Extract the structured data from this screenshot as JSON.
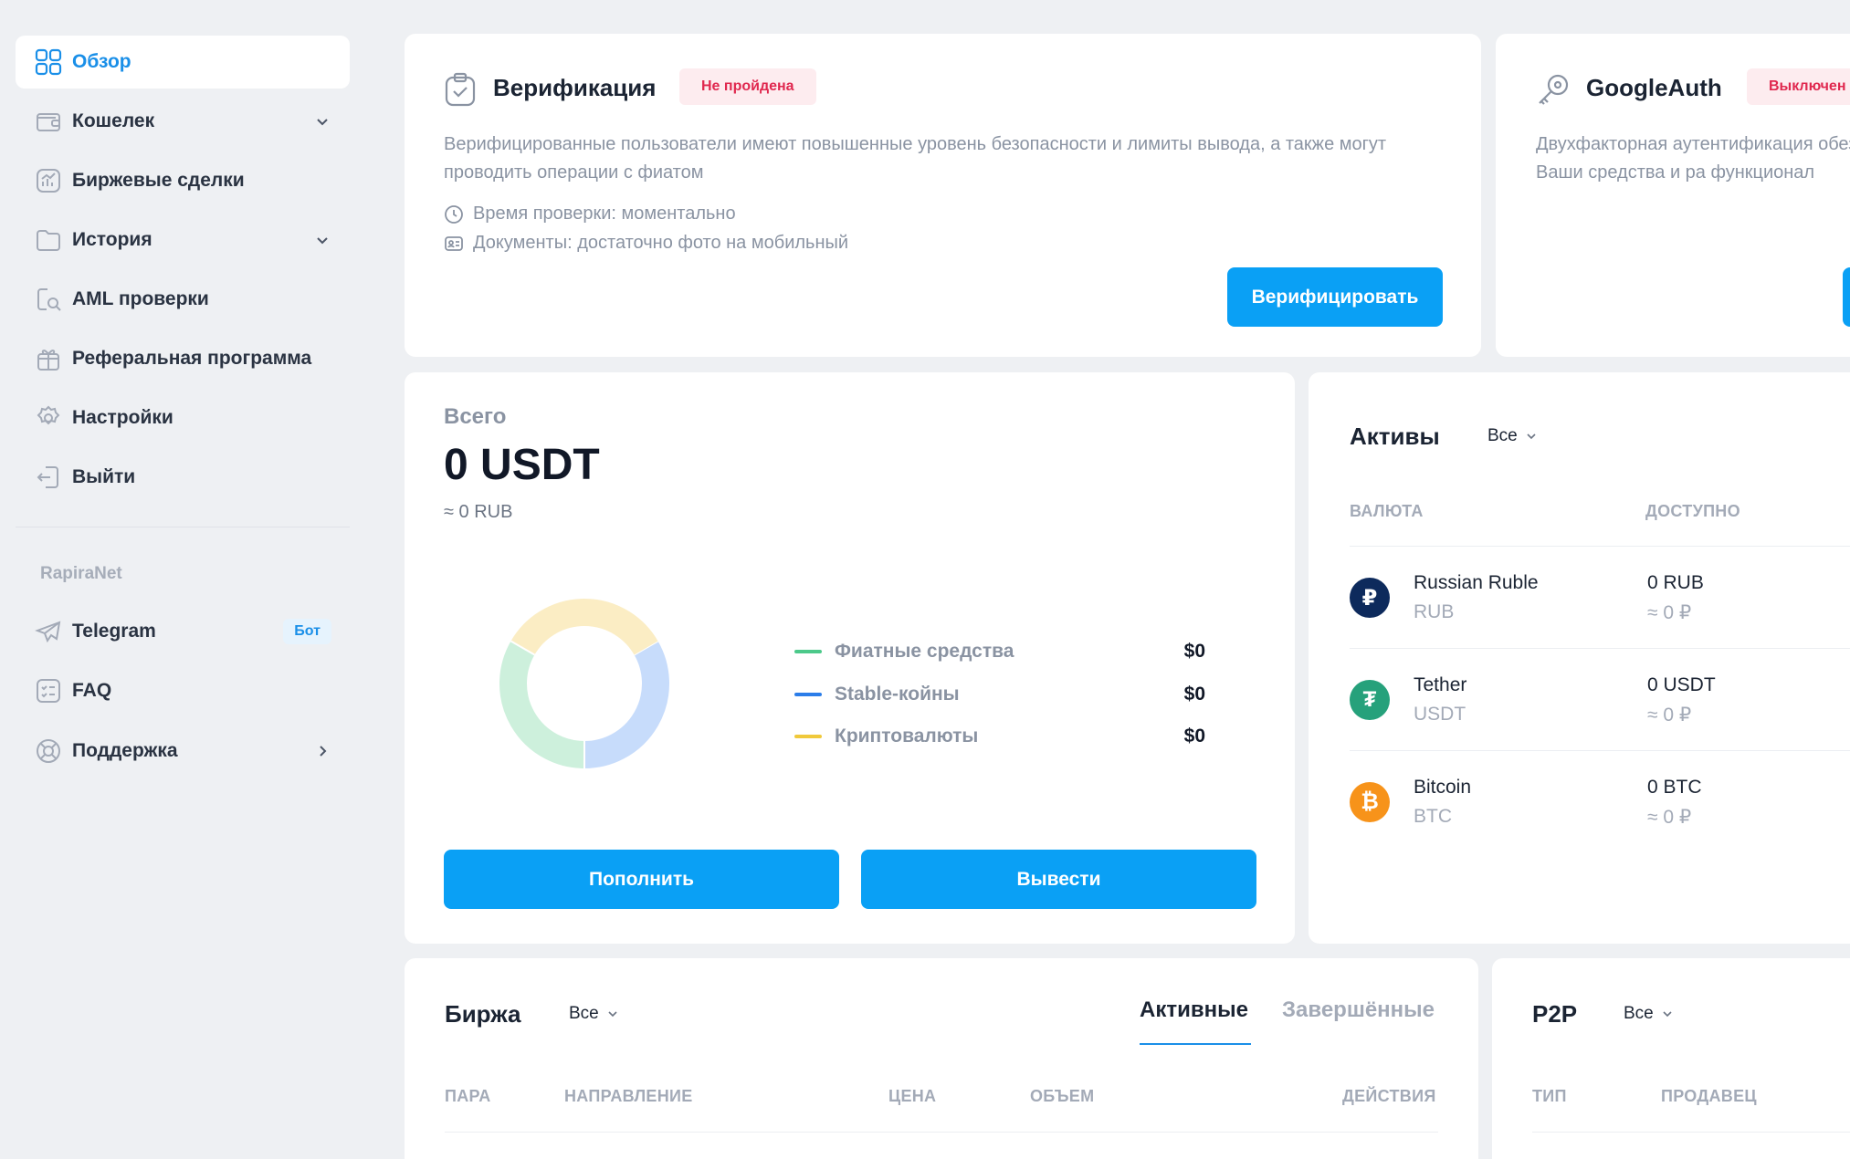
{
  "sidebar": {
    "items": [
      {
        "label": "Обзор",
        "icon": "grid-icon"
      },
      {
        "label": "Кошелек",
        "icon": "wallet-icon"
      },
      {
        "label": "Биржевые сделки",
        "icon": "chart-icon"
      },
      {
        "label": "История",
        "icon": "folder-icon"
      },
      {
        "label": "AML проверки",
        "icon": "magnifier-icon"
      },
      {
        "label": "Реферальная программа",
        "icon": "gift-icon"
      },
      {
        "label": "Настройки",
        "icon": "gear-icon"
      },
      {
        "label": "Выйти",
        "icon": "logout-icon"
      }
    ],
    "section_title": "RapiraNet",
    "extra": [
      {
        "label": "Telegram",
        "icon": "telegram-icon",
        "badge": "Бот"
      },
      {
        "label": "FAQ",
        "icon": "faq-icon"
      },
      {
        "label": "Поддержка",
        "icon": "lifebuoy-icon"
      }
    ]
  },
  "verification": {
    "title": "Верификация",
    "status": "Не пройдена",
    "description": "Верифицированные пользователи имеют повышенные уровень безопасности и лимиты вывода, а также могут проводить операции с фиатом",
    "time": "Время проверки: моментально",
    "documents": "Документы: достаточно фото на мобильный",
    "button": "Верифицировать"
  },
  "google_auth": {
    "title": "GoogleAuth",
    "status": "Выключен",
    "description": "Двухфакторная аутентификация обезопасить Ваши средства и ра функционал"
  },
  "balance": {
    "label": "Всего",
    "amount": "0 USDT",
    "rub": "≈ 0 RUB",
    "deposit_button": "Пополнить",
    "withdraw_button": "Вывести"
  },
  "chart_data": {
    "type": "pie",
    "categories": [
      "Фиатные средства",
      "Stable-койны",
      "Криптовалюты"
    ],
    "values": [
      0,
      0,
      0
    ],
    "value_labels": [
      "$0",
      "$0",
      "$0"
    ],
    "colors": [
      "#4cc98a",
      "#2b7de9",
      "#f0c93b"
    ],
    "ring_fill_colors": [
      "#cdf0dc",
      "#c7dcfb",
      "#fbedc4"
    ]
  },
  "assets": {
    "title": "Активы",
    "filter": "Все",
    "col_currency": "ВАЛЮТА",
    "col_available": "ДОСТУПНО",
    "rows": [
      {
        "name": "Russian Ruble",
        "code": "RUB",
        "amount": "0 RUB",
        "conv": "≈ 0 ₽",
        "color": "#0d2a5c",
        "glyph": "₽"
      },
      {
        "name": "Tether",
        "code": "USDT",
        "amount": "0 USDT",
        "conv": "≈ 0 ₽",
        "color": "#26a17b",
        "glyph": "₮"
      },
      {
        "name": "Bitcoin",
        "code": "BTC",
        "amount": "0 BTC",
        "conv": "≈ 0 ₽",
        "color": "#f7931a",
        "glyph": "₿"
      }
    ]
  },
  "exchange": {
    "title": "Биржа",
    "filter": "Все",
    "tab_active": "Активные",
    "tab_done": "Завершённые",
    "columns": [
      "ПАРА",
      "НАПРАВЛЕНИЕ",
      "ЦЕНА",
      "ОБЪЕМ",
      "ДЕЙСТВИЯ"
    ]
  },
  "p2p": {
    "title": "P2P",
    "filter": "Все",
    "columns": [
      "ТИП",
      "ПРОДАВЕЦ"
    ]
  }
}
